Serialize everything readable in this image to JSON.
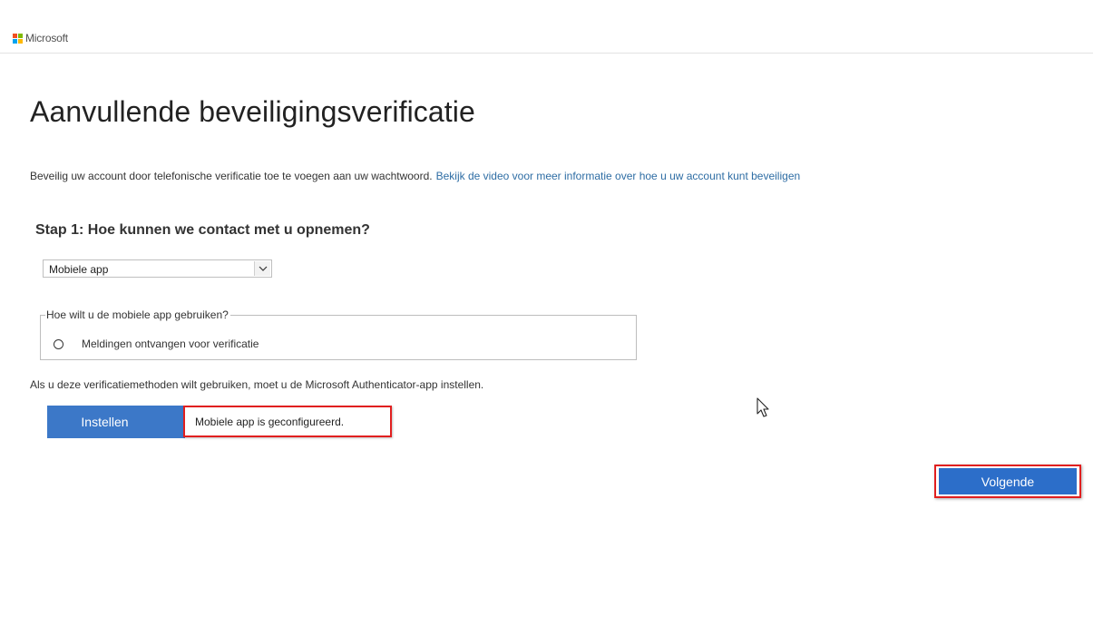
{
  "header": {
    "brand": "Microsoft",
    "logo_colors": [
      "#f25022",
      "#7fba00",
      "#00a4ef",
      "#ffb900"
    ]
  },
  "main": {
    "title": "Aanvullende beveiligingsverificatie",
    "intro_text": "Beveilig uw account door telefonische verificatie toe te voegen aan uw wachtwoord.",
    "intro_link": "Bekijk de video voor meer informatie over hoe u uw account kunt beveiligen",
    "step_title": "Stap 1: Hoe kunnen we contact met u opnemen?",
    "method_select": {
      "selected": "Mobiele app"
    },
    "usage_group": {
      "legend": "Hoe wilt u de mobiele app gebruiken?",
      "option_label": "Meldingen ontvangen voor verificatie"
    },
    "setup_note": "Als u deze verificatiemethoden wilt gebruiken, moet u de Microsoft Authenticator-app instellen.",
    "setup_button": "Instellen",
    "setup_status": "Mobiele app is geconfigureerd.",
    "next_button": "Volgende"
  },
  "colors": {
    "accent_button": "#3c78c8",
    "highlight_border": "#e11f1f",
    "link": "#2e6da4"
  }
}
